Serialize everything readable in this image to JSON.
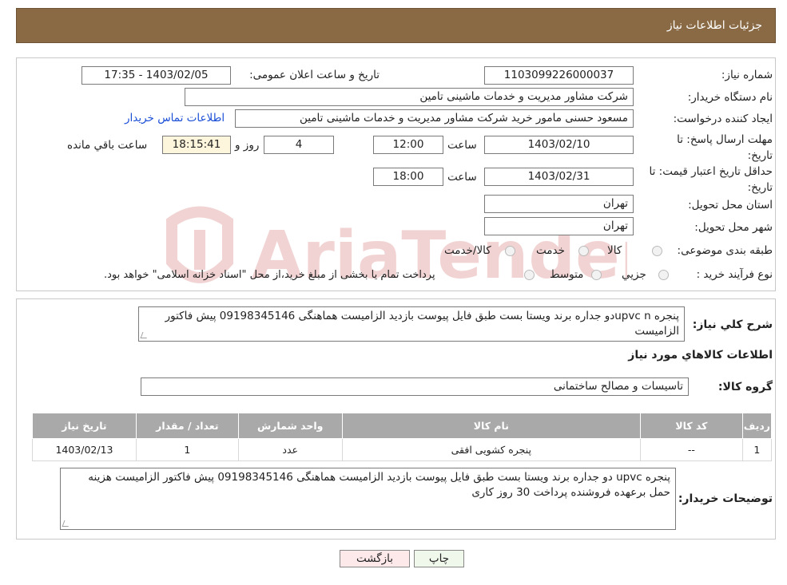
{
  "header": {
    "title": "جزئیات اطلاعات نیاز"
  },
  "watermark": {
    "text": "AriaTender.neT"
  },
  "fields": {
    "need_number_label": "شماره نیاز:",
    "need_number": "1103099226000037",
    "announce_label": "تاریخ و ساعت اعلان عمومی:",
    "announce_value": "1403/02/05 - 17:35",
    "buyer_org_label": "نام دستگاه خریدار:",
    "buyer_org": "شرکت مشاور مدیریت و خدمات ماشینی تامین",
    "creator_label": "ایجاد کننده درخواست:",
    "creator": "مسعود حسنی مامور خرید شرکت مشاور مدیریت و خدمات ماشینی تامین",
    "contact_link": "اطلاعات تماس خریدار",
    "deadline_label": "مهلت ارسال پاسخ: تا تاریخ:",
    "deadline_date": "1403/02/10",
    "time_label": "ساعت",
    "deadline_time": "12:00",
    "days_value": "4",
    "days_label": "روز و",
    "remaining_time": "18:15:41",
    "remaining_label": "ساعت باقي مانده",
    "validity_label": "حداقل تاریخ اعتبار قیمت: تا تاریخ:",
    "validity_date": "1403/02/31",
    "validity_time": "18:00",
    "province_label": "استان محل تحویل:",
    "province": "تهران",
    "city_label": "شهر محل تحویل:",
    "city": "تهران",
    "category_label": "طبقه بندی موضوعی:",
    "category_options": [
      "کالا",
      "خدمت",
      "کالا/خدمت"
    ],
    "process_label": "نوع فرآیند خرید :",
    "process_options": [
      "جزيي",
      "متوسط"
    ],
    "process_note": "پرداخت تمام یا بخشی از مبلغ خرید،از محل \"اسناد خزانه اسلامی\" خواهد بود."
  },
  "description": {
    "label": "شرح كلي نياز:",
    "text": "پنجره upvc nدو جداره برند   ویستا بست  طبق فایل پیوست  بازدید الزامیست   هماهنگی 09198345146 پیش فاکتور الزامیست"
  },
  "goods_title": "اطلاعات كالاهاي مورد نياز",
  "group": {
    "label": "گروه کالا:",
    "value": "تاسیسات و مصالح ساختمانی"
  },
  "table": {
    "headers": [
      "رديف",
      "کد کالا",
      "نام کالا",
      "واحد شمارش",
      "تعداد / مقدار",
      "تاریخ نیاز"
    ],
    "rows": [
      [
        "1",
        "--",
        "پنجره کشویی افقی",
        "عدد",
        "1",
        "1403/02/13"
      ]
    ]
  },
  "buyer_notes": {
    "label": "توضیحات خریدار:",
    "text": "پنجره upvc  دو جداره برند   ویستا بست  طبق فایل پیوست  بازدید الزامیست   هماهنگی 09198345146  پیش فاکتور الزامیست هزینه حمل برعهده فروشنده   پرداخت 30 روز کاری"
  },
  "buttons": {
    "print": "چاپ",
    "back": "بازگشت"
  }
}
